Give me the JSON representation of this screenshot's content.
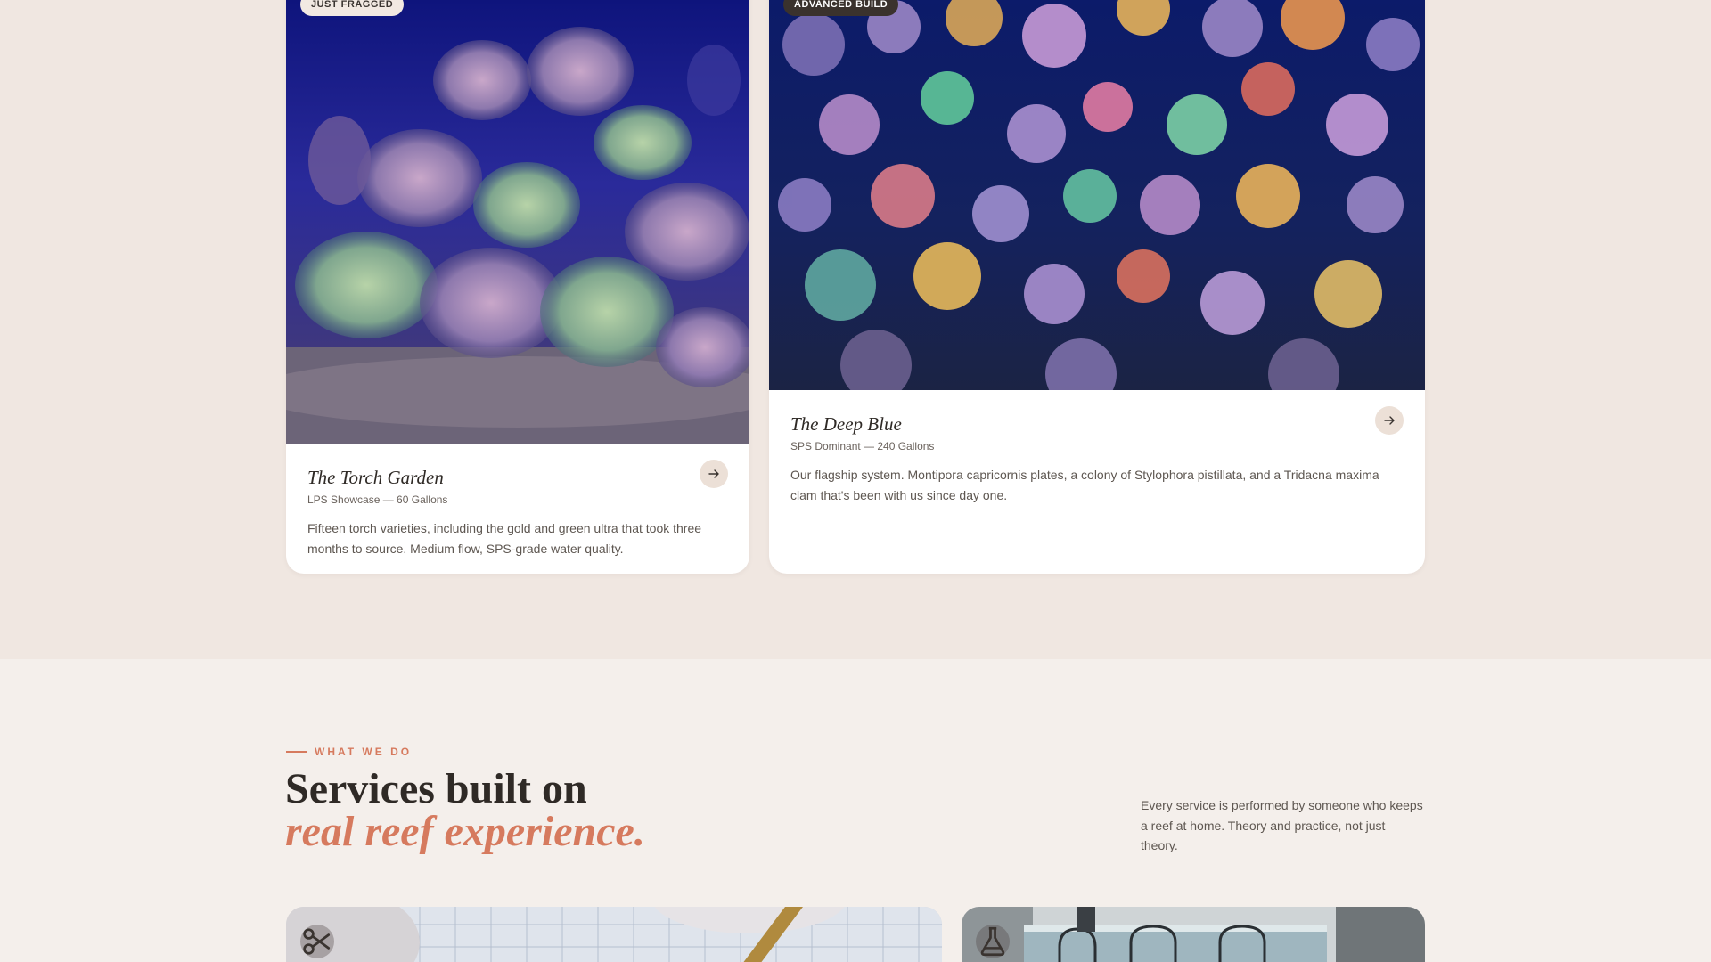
{
  "gallery": {
    "cards": [
      {
        "badge": "JUST FRAGGED",
        "title": "The Torch Garden",
        "subtitle": "LPS Showcase — 60 Gallons",
        "description": "Fifteen torch varieties, including the gold and green ultra that took three months to source. Medium flow, SPS-grade water quality.",
        "arrow_icon": "arrow-right-icon"
      },
      {
        "badge": "ADVANCED BUILD",
        "title": "The Deep Blue",
        "subtitle": "SPS Dominant — 240 Gallons",
        "description": "Our flagship system. Montipora capricornis plates, a colony of Stylophora pistillata, and a Tridacna maxima clam that's been with us since day one.",
        "arrow_icon": "arrow-right-icon"
      }
    ]
  },
  "services": {
    "eyebrow": "WHAT WE DO",
    "heading_line1": "Services built on",
    "heading_line2": "real reef experience.",
    "intro": "Every service is performed by someone who keeps a reef at home. Theory and practice, not just theory.",
    "cards": [
      {
        "icon": "scissors-icon"
      },
      {
        "icon": "flask-icon"
      }
    ]
  },
  "colors": {
    "page_bg": "#f0e7e1",
    "accent": "#d67a5e",
    "text_dark": "#2f2a26",
    "badge_dark": "#3a322d"
  }
}
